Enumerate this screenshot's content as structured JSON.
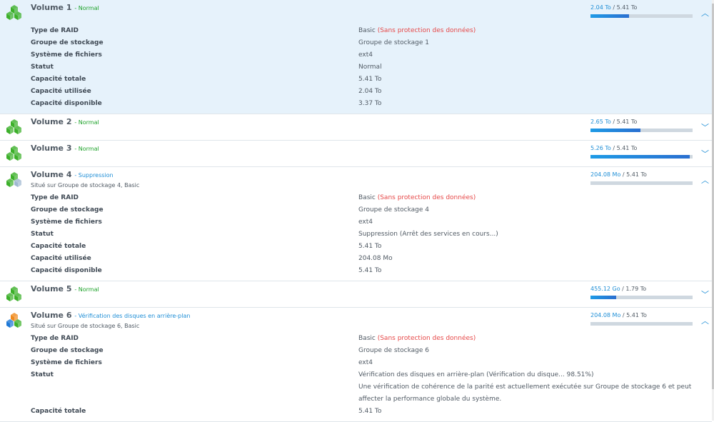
{
  "colors": {
    "accent": "#1e8ed6",
    "normal": "#1fa32b",
    "warning": "#e64848",
    "selected_bg": "#e6f2fb"
  },
  "volumes": [
    {
      "name": "Volume 1",
      "status": "Normal",
      "status_color": "green",
      "used": "2.04 To",
      "total": "5.41 To",
      "usage_fraction": 0.377,
      "expanded": true,
      "selected": true,
      "icon": "volume-green-cubes-icon",
      "details": [
        {
          "label": "Type de RAID",
          "value": "Basic",
          "note": "(Sans protection des données)",
          "note_color": "red"
        },
        {
          "label": "Groupe de stockage",
          "value": "Groupe de stockage 1"
        },
        {
          "label": "Système de fichiers",
          "value": "ext4"
        },
        {
          "label": "Statut",
          "value": "Normal",
          "value_color": "green"
        },
        {
          "label": "Capacité totale",
          "value": "5.41 To"
        },
        {
          "label": "Capacité utilisée",
          "value": "2.04 To"
        },
        {
          "label": "Capacité disponible",
          "value": "3.37 To"
        }
      ]
    },
    {
      "name": "Volume 2",
      "status": "Normal",
      "status_color": "green",
      "used": "2.65 To",
      "total": "5.41 To",
      "usage_fraction": 0.49,
      "expanded": false,
      "icon": "volume-green-cubes-icon"
    },
    {
      "name": "Volume 3",
      "status": "Normal",
      "status_color": "green",
      "used": "5.26 To",
      "total": "5.41 To",
      "usage_fraction": 0.972,
      "expanded": false,
      "icon": "volume-green-cubes-icon"
    },
    {
      "name": "Volume 4",
      "status": "Suppression",
      "status_color": "blue",
      "subtitle": "Situé sur Groupe de stockage 4, Basic",
      "used": "204.08 Mo",
      "total": "5.41 To",
      "usage_fraction": 0.0,
      "expanded": true,
      "icon": "volume-deleting-icon",
      "details": [
        {
          "label": "Type de RAID",
          "value": "Basic",
          "note": "(Sans protection des données)",
          "note_color": "red"
        },
        {
          "label": "Groupe de stockage",
          "value": "Groupe de stockage 4"
        },
        {
          "label": "Système de fichiers",
          "value": "ext4"
        },
        {
          "label": "Statut",
          "value": "Suppression (Arrêt des services en cours...)",
          "value_color": "blue"
        },
        {
          "label": "Capacité totale",
          "value": "5.41 To"
        },
        {
          "label": "Capacité utilisée",
          "value": "204.08 Mo"
        },
        {
          "label": "Capacité disponible",
          "value": "5.41 To"
        }
      ]
    },
    {
      "name": "Volume 5",
      "status": "Normal",
      "status_color": "green",
      "used": "455.12 Go",
      "total": "1.79 To",
      "usage_fraction": 0.25,
      "expanded": false,
      "icon": "volume-green-cubes-icon"
    },
    {
      "name": "Volume 6",
      "status": "Vérification des disques en arrière-plan",
      "status_color": "blue",
      "subtitle": "Situé sur Groupe de stockage 6, Basic",
      "used": "204.08 Mo",
      "total": "5.41 To",
      "usage_fraction": 0.0,
      "expanded": true,
      "icon": "volume-checking-icon",
      "details": [
        {
          "label": "Type de RAID",
          "value": "Basic",
          "note": "(Sans protection des données)",
          "note_color": "red"
        },
        {
          "label": "Groupe de stockage",
          "value": "Groupe de stockage 6"
        },
        {
          "label": "Système de fichiers",
          "value": "ext4"
        },
        {
          "label": "Statut",
          "value": "Vérification des disques en arrière-plan (Vérification du disque... 98.51%)",
          "value_color": "blue"
        },
        {
          "label": "",
          "value": "Une vérification de cohérence de la parité est actuellement exécutée sur Groupe de stockage 6 et peut",
          "value_color": "red"
        },
        {
          "label": "",
          "value": "affecter la performance globale du système.",
          "value_color": "red"
        },
        {
          "label": "Capacité totale",
          "value": "5.41 To"
        }
      ]
    }
  ]
}
